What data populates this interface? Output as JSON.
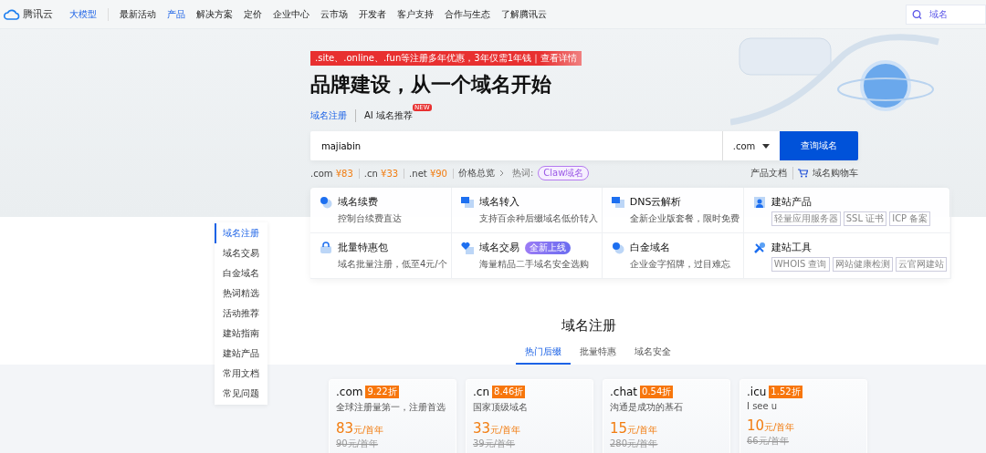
{
  "nav": {
    "logo": "腾讯云",
    "items": [
      {
        "label": "大模型",
        "highlight": true
      },
      {
        "label": "最新活动",
        "highlight": false
      },
      {
        "label": "产品",
        "highlight": true
      },
      {
        "label": "解决方案",
        "highlight": false
      },
      {
        "label": "定价",
        "highlight": false
      },
      {
        "label": "企业中心",
        "highlight": false
      },
      {
        "label": "云市场",
        "highlight": false
      },
      {
        "label": "开发者",
        "highlight": false
      },
      {
        "label": "客户支持",
        "highlight": false
      },
      {
        "label": "合作与生态",
        "highlight": false
      },
      {
        "label": "了解腾讯云",
        "highlight": false
      }
    ],
    "search_placeholder": "域名"
  },
  "hero": {
    "promo": ".site、.online、.fun等注册多年优惠，3年仅需1年钱｜查看详情",
    "title": "品牌建设，从一个域名开始",
    "modes": [
      {
        "label": "域名注册",
        "selected": true
      },
      {
        "label": "AI 域名推荐",
        "selected": false,
        "badge": "NEW"
      }
    ],
    "search_value": "majiabin",
    "suffix": ".com",
    "search_button": "查询域名",
    "prices": [
      {
        "suffix": ".com",
        "price": "¥83"
      },
      {
        "suffix": ".cn",
        "price": "¥33"
      },
      {
        "suffix": ".net",
        "price": "¥90"
      }
    ],
    "overview_link": "价格总览",
    "hot_label": "热词:",
    "hot_tag": "Claw域名",
    "doc_link": "产品文档",
    "cart_link": "域名购物车"
  },
  "features": [
    {
      "kind": "desc",
      "title": "域名续费",
      "desc": "控制台续费直达"
    },
    {
      "kind": "desc",
      "title": "域名转入",
      "desc": "支持百余种后缀域名低价转入"
    },
    {
      "kind": "desc",
      "title": "DNS云解析",
      "desc": "全新企业版套餐，限时免费"
    },
    {
      "kind": "tags",
      "title": "建站产品",
      "tags": [
        "轻量应用服务器",
        "SSL 证书",
        "ICP 备案"
      ]
    },
    {
      "kind": "desc",
      "title": "批量特惠包",
      "desc": "域名批量注册，低至4元/个"
    },
    {
      "kind": "desc",
      "title": "域名交易",
      "desc": "海量精品二手域名安全选购",
      "badge": "全新上线"
    },
    {
      "kind": "desc",
      "title": "白金域名",
      "desc": "企业金字招牌，过目难忘"
    },
    {
      "kind": "tags",
      "title": "建站工具",
      "tags": [
        "WHOIS 查询",
        "网站健康检测",
        "云官网建站"
      ]
    }
  ],
  "sidebar": [
    {
      "label": "域名注册",
      "selected": true
    },
    {
      "label": "域名交易",
      "selected": false
    },
    {
      "label": "白金域名",
      "selected": false
    },
    {
      "label": "热词精选",
      "selected": false
    },
    {
      "label": "活动推荐",
      "selected": false
    },
    {
      "label": "建站指南",
      "selected": false
    },
    {
      "label": "建站产品",
      "selected": false
    },
    {
      "label": "常用文档",
      "selected": false
    },
    {
      "label": "常见问题",
      "selected": false
    }
  ],
  "section": {
    "title": "域名注册",
    "tabs": [
      {
        "label": "热门后缀",
        "selected": true
      },
      {
        "label": "批量特惠",
        "selected": false
      },
      {
        "label": "域名安全",
        "selected": false
      }
    ]
  },
  "offers": [
    {
      "suffix": ".com",
      "discount": "9.22折",
      "desc": "全球注册量第一，注册首选",
      "price": "83",
      "unit": "元/首年",
      "original": "90元/首年"
    },
    {
      "suffix": ".cn",
      "discount": "8.46折",
      "desc": "国家顶级域名",
      "price": "33",
      "unit": "元/首年",
      "original": "39元/首年"
    },
    {
      "suffix": ".chat",
      "discount": "0.54折",
      "desc": "沟通是成功的基石",
      "price": "15",
      "unit": "元/首年",
      "original": "280元/首年"
    },
    {
      "suffix": ".icu",
      "discount": "1.52折",
      "desc": "I see u",
      "price": "10",
      "unit": "元/首年",
      "original": "66元/首年"
    }
  ]
}
